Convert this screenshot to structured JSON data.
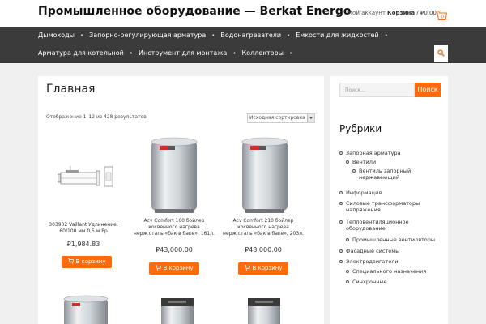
{
  "header": {
    "title": "Промышленное оборудование — Berkat Energo",
    "account": "Мой аккаунт",
    "cart_label": "Корзина",
    "cart_total": " / ₽0.00",
    "cart_count": "0"
  },
  "nav": {
    "row1": [
      "Дымоходы",
      "Запорно-регулирующая арматура",
      "Водонагреватели",
      "Емкости для жидкостей"
    ],
    "row2": [
      "Арматура для котельной",
      "Инструмент для монтажа",
      "Коллекторы"
    ]
  },
  "main": {
    "page_title": "Главная",
    "result_count": "Отображение 1–12 из 428 результатов",
    "sort": {
      "selected": "Исходная сортировка"
    },
    "products": [
      {
        "name": "303902 Vaillant Удлинение, 60/100 мм 0,5 м Рр",
        "price": "₽1,984.83",
        "button": "В корзину"
      },
      {
        "name": "Acv Comfort 160 бойлер косвенного нагрева нерж.сталь «бак в баке», 161л.",
        "price": "₽43,000.00",
        "button": "В корзину"
      },
      {
        "name": "Acv Comfort 210 бойлер косвенного нагрева нерж.сталь «бак в баке», 203л.",
        "price": "₽48,000.00",
        "button": "В корзину"
      }
    ]
  },
  "sidebar": {
    "search_placeholder": "Поиск…",
    "search_button": "Поиск",
    "categories_title": "Рубрики",
    "categories": [
      {
        "label": "Запорная арматура",
        "level": 0
      },
      {
        "label": "Вентили",
        "level": 1
      },
      {
        "label": "Вентиль запорный нержавеющий",
        "level": 2
      },
      {
        "label": "Информация",
        "level": 0
      },
      {
        "label": "Силовые трансформаторы напряжения",
        "level": 0
      },
      {
        "label": "Тепловентиляционное оборудование",
        "level": 0
      },
      {
        "label": "Промышленные вентиляторы",
        "level": 1
      },
      {
        "label": "Фасадные системы",
        "level": 0
      },
      {
        "label": "Электродвигатели",
        "level": 0
      },
      {
        "label": "Специального назначения",
        "level": 1
      },
      {
        "label": "Синхронные",
        "level": 1
      }
    ]
  },
  "colors": {
    "accent": "#ff6a0d",
    "nav_bg": "#3b3b3b",
    "page_bg": "#f0f0f0"
  }
}
